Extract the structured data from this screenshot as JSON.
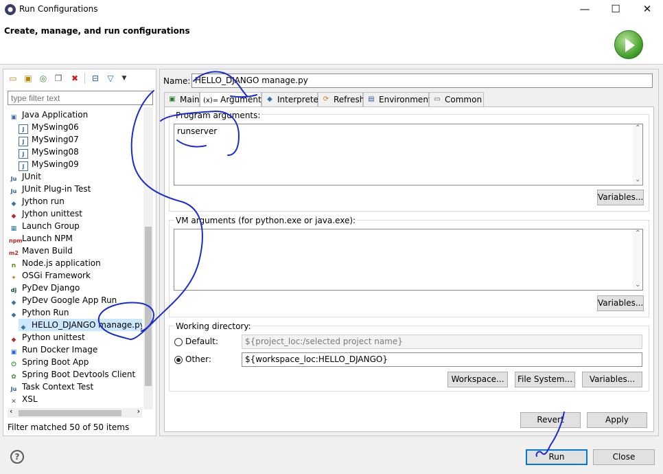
{
  "window": {
    "title": "Run Configurations",
    "minimize": "—",
    "maximize": "☐",
    "close": "✕"
  },
  "banner": {
    "heading": "Create, manage, and run configurations"
  },
  "left": {
    "filter_placeholder": "type filter text",
    "filter_status": "Filter matched 50 of 50 items",
    "tree": [
      {
        "label": "Java Application",
        "icon": "java-app-icon",
        "level": 0
      },
      {
        "label": "MySwing06",
        "icon": "java-file-icon",
        "level": 1
      },
      {
        "label": "MySwing07",
        "icon": "java-file-icon",
        "level": 1
      },
      {
        "label": "MySwing08",
        "icon": "java-file-icon",
        "level": 1
      },
      {
        "label": "MySwing09",
        "icon": "java-file-icon",
        "level": 1
      },
      {
        "label": "JUnit",
        "icon": "junit-icon",
        "level": 0
      },
      {
        "label": "JUnit Plug-in Test",
        "icon": "junit-plugin-icon",
        "level": 0
      },
      {
        "label": "Jython run",
        "icon": "jython-icon",
        "level": 0
      },
      {
        "label": "Jython unittest",
        "icon": "jython-unittest-icon",
        "level": 0
      },
      {
        "label": "Launch Group",
        "icon": "launch-group-icon",
        "level": 0
      },
      {
        "label": "Launch NPM",
        "icon": "npm-icon",
        "level": 0
      },
      {
        "label": "Maven Build",
        "icon": "maven-icon",
        "level": 0
      },
      {
        "label": "Node.js application",
        "icon": "nodejs-icon",
        "level": 0
      },
      {
        "label": "OSGi Framework",
        "icon": "osgi-icon",
        "level": 0
      },
      {
        "label": "PyDev Django",
        "icon": "django-icon",
        "level": 0
      },
      {
        "label": "PyDev Google App Run",
        "icon": "google-app-icon",
        "level": 0
      },
      {
        "label": "Python Run",
        "icon": "python-icon",
        "level": 0
      },
      {
        "label": "HELLO_DJANGO manage.py",
        "icon": "python-file-icon",
        "level": 1,
        "selected": true
      },
      {
        "label": "Python unittest",
        "icon": "python-unittest-icon",
        "level": 0
      },
      {
        "label": "Run Docker Image",
        "icon": "docker-icon",
        "level": 0
      },
      {
        "label": "Spring Boot App",
        "icon": "spring-boot-icon",
        "level": 0
      },
      {
        "label": "Spring Boot Devtools Client",
        "icon": "spring-devtools-icon",
        "level": 0
      },
      {
        "label": "Task Context Test",
        "icon": "task-context-icon",
        "level": 0
      },
      {
        "label": "XSL",
        "icon": "xsl-icon",
        "level": 0
      }
    ]
  },
  "config": {
    "name_label": "Name:",
    "name_value": "HELLO_DJANGO manage.py",
    "tabs": [
      {
        "label": "Main",
        "icon": "main-tab-icon"
      },
      {
        "label": "Arguments",
        "icon": "arguments-tab-icon",
        "icon_text": "(x)=",
        "active": true
      },
      {
        "label": "Interpreter",
        "icon": "python-icon"
      },
      {
        "label": "Refresh",
        "icon": "refresh-icon"
      },
      {
        "label": "Environment",
        "icon": "environment-icon"
      },
      {
        "label": "Common",
        "icon": "common-icon"
      }
    ],
    "program_args_label": "Program arguments:",
    "program_args_value": "runserver",
    "vm_args_label": "VM arguments (for python.exe or java.exe):",
    "vm_args_value": "",
    "variables_label": "Variables...",
    "working_dir_label": "Working directory:",
    "default_label": "Default:",
    "default_value": "${project_loc:/selected project name}",
    "other_label": "Other:",
    "other_value": "${workspace_loc:HELLO_DJANGO}",
    "workspace_btn": "Workspace...",
    "filesystem_btn": "File System...",
    "revert_btn": "Revert",
    "apply_btn": "Apply"
  },
  "footer": {
    "run_btn": "Run",
    "close_btn": "Close",
    "help": "?"
  }
}
